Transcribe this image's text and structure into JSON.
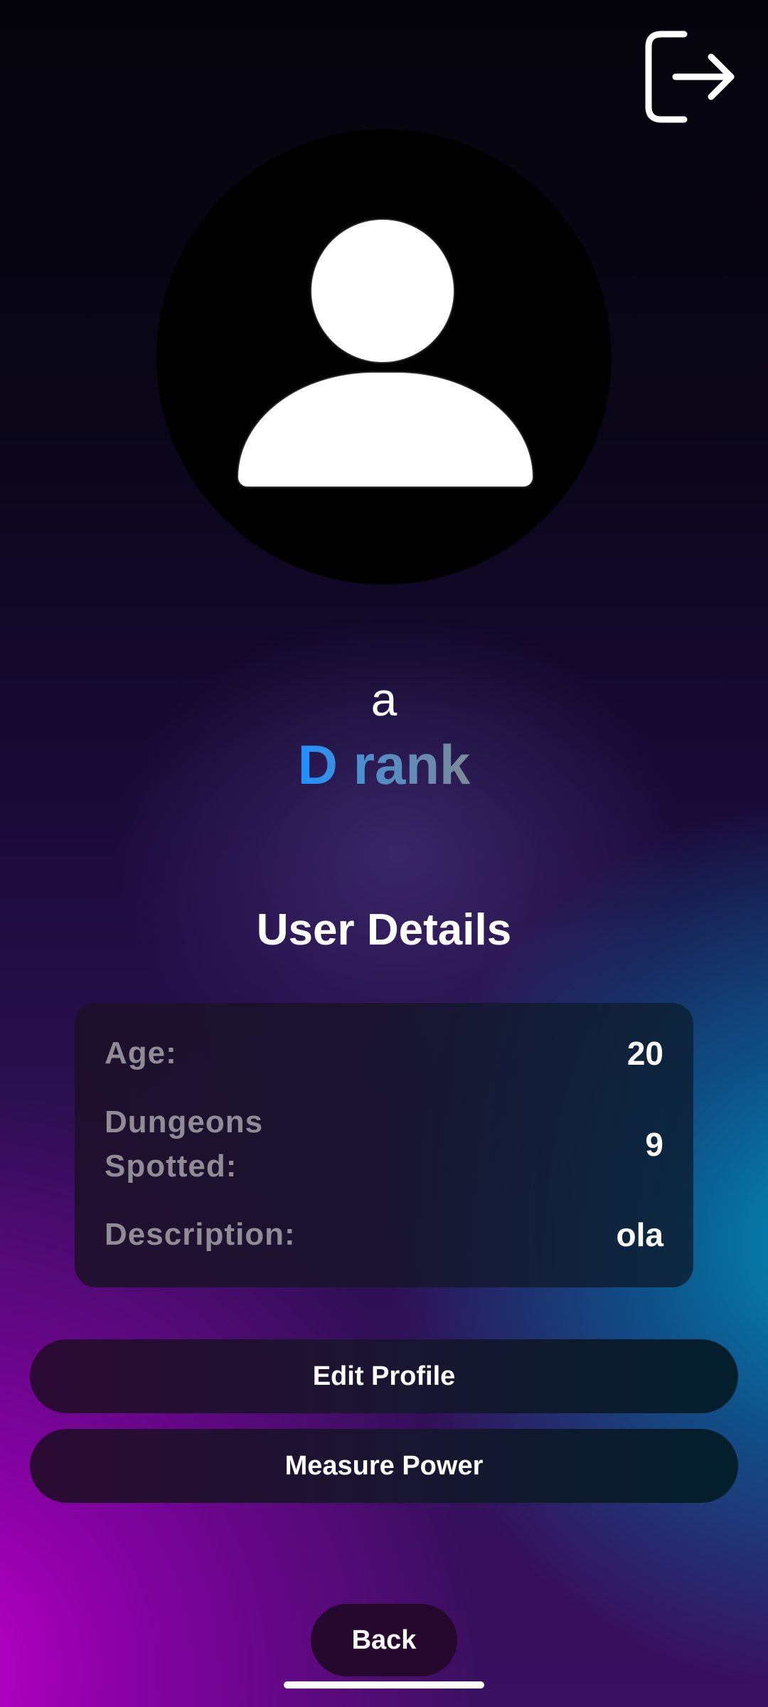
{
  "header": {
    "logout_icon": "logout-icon"
  },
  "profile": {
    "avatar_icon": "user-avatar-icon",
    "name": "a",
    "rank": "D rank"
  },
  "details": {
    "title": "User Details",
    "rows": [
      {
        "label": "Age:",
        "value": "20"
      },
      {
        "label": "Dungeons Spotted:",
        "value": "9"
      },
      {
        "label": "Description:",
        "value": "ola"
      }
    ]
  },
  "actions": {
    "edit_profile": "Edit Profile",
    "measure_power": "Measure Power",
    "back": "Back"
  },
  "colors": {
    "rank_gradient_start": "#1f8fff",
    "rank_gradient_end": "#7c8a99",
    "label_gray": "#8f8c95",
    "background_magenta": "#be00c8",
    "background_cyan": "#0096be"
  }
}
